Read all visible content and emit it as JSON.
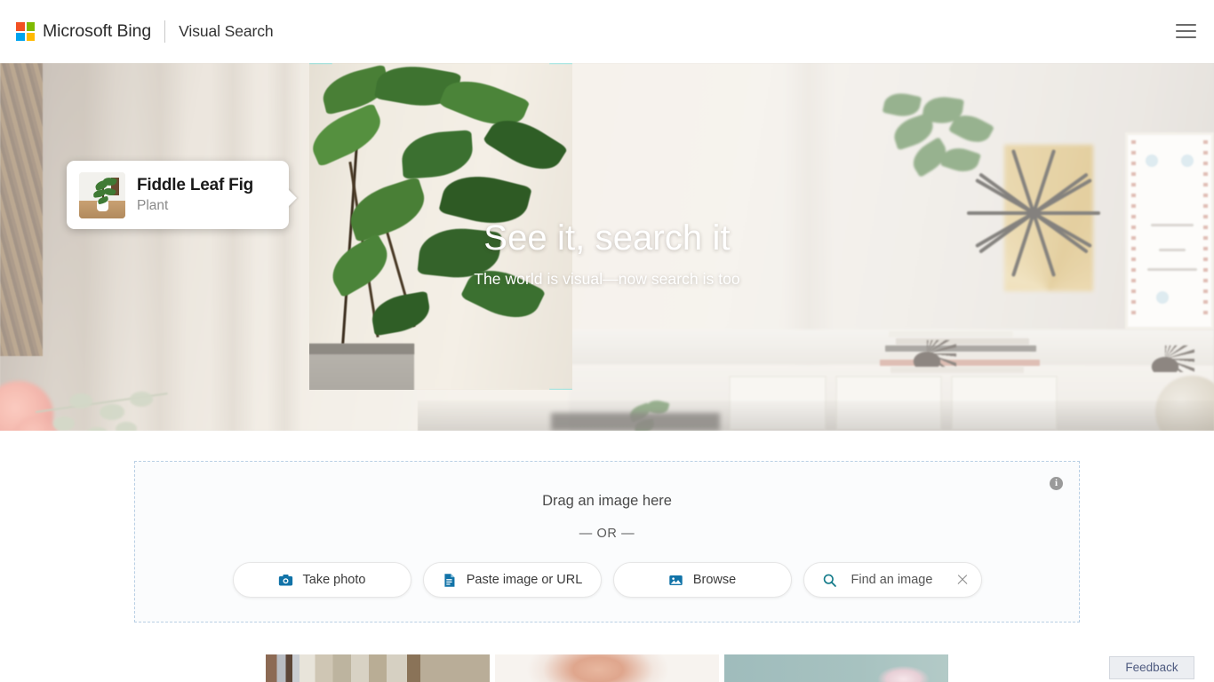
{
  "header": {
    "logo_icon": "microsoft-squares-icon",
    "brand": "Microsoft Bing",
    "section": "Visual Search",
    "menu_icon": "hamburger-menu-icon",
    "logo_colors": [
      "#f25022",
      "#7fba00",
      "#00a4ef",
      "#ffb900"
    ]
  },
  "hero": {
    "headline": "See it, search it",
    "subhead": "The world is visual—now search is too",
    "crop_corner_color": "#27e2ea",
    "result_card": {
      "title": "Fiddle Leaf Fig",
      "subtitle": "Plant",
      "thumbnail_icon": "fiddle-leaf-fig-thumbnail"
    }
  },
  "dropzone": {
    "title": "Drag an image here",
    "or": "— OR —",
    "info_icon": "info-icon",
    "info_glyph": "i",
    "buttons": [
      {
        "label": "Take photo",
        "icon": "camera-icon"
      },
      {
        "label": "Paste image or URL",
        "icon": "paste-document-icon"
      },
      {
        "label": "Browse",
        "icon": "image-picture-icon"
      }
    ],
    "search": {
      "placeholder": "Find an image",
      "value": "",
      "icon": "search-magnifier-icon",
      "clear_icon": "close-x-icon",
      "accent": "#1a7f8e"
    },
    "border_color": "#b9cfe4"
  },
  "thumbnails": [
    {
      "name": "interior-curtains-thumbnail"
    },
    {
      "name": "hands-skin-thumbnail"
    },
    {
      "name": "flower-teal-thumbnail"
    }
  ],
  "footer": {
    "feedback_label": "Feedback"
  }
}
